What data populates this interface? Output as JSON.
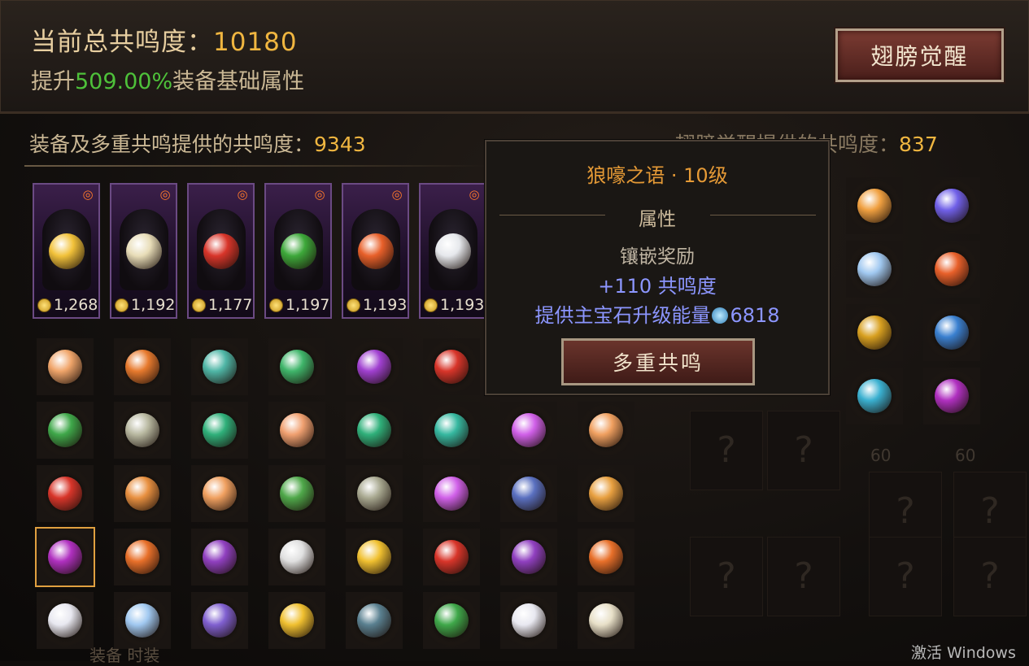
{
  "header": {
    "total_label": "当前总共鸣度：",
    "total_value": "10180",
    "boost_prefix": "提升",
    "boost_percent": "509.00%",
    "boost_suffix": "装备基础属性",
    "awaken_button": "翅膀觉醒"
  },
  "totals": {
    "left_label": "装备及多重共鸣提供的共鸣度：",
    "left_value": "9343",
    "right_label": "翅膀觉醒提供的共鸣度：",
    "right_value": "837"
  },
  "equipment_cards": [
    {
      "price": "1,268",
      "gem_color": "#f2c23a"
    },
    {
      "price": "1,192",
      "gem_color": "#e8ddb8"
    },
    {
      "price": "1,177",
      "gem_color": "#d8352a"
    },
    {
      "price": "1,197",
      "gem_color": "#3da83a"
    },
    {
      "price": "1,193",
      "gem_color": "#e8602a"
    },
    {
      "price": "1,193",
      "gem_color": "#e6e8ec"
    }
  ],
  "tooltip": {
    "title": "狼嚎之语 · 10级",
    "section": "属性",
    "bonus_title": "镶嵌奖励",
    "bonus_value": "+110 共鸣度",
    "energy_label": "提供主宝石升级能量",
    "energy_value": "6818",
    "multi_button": "多重共鸣"
  },
  "gem_grid": [
    [
      "#f0a56a",
      "#e77a2e",
      "#4fb6a6",
      "#3fb56a",
      "#a040d0",
      "#d8352a"
    ],
    [
      "#3fa84a",
      "#b8b8a0",
      "#2fb07a",
      "#f0a070",
      "#2fb07a",
      "#36b8a0",
      "#d060e8",
      "#f0a060"
    ],
    [
      "#d8352a",
      "#e89040",
      "#f0a060",
      "#4fa84a",
      "#a8a890",
      "#d060e8",
      "#5a70c0",
      "#e8a040"
    ],
    [
      "#b030c0",
      "#e8702a",
      "#9040c0",
      "#e0e0e0",
      "#f0c030",
      "#d8352a",
      "#9040c0",
      "#e8702a"
    ],
    [
      "#e8e8f0",
      "#a0c8f0",
      "#8060d0",
      "#f0c030",
      "#5a8090",
      "#3fa84a",
      "#e8e8f0",
      "#e8e0c8"
    ]
  ],
  "right_gems": [
    "#f0a040",
    "#7060e8",
    "#a0c8f0",
    "#e8602a",
    "#d8a020",
    "#3a80d0",
    "#3ab0d0",
    "#b030c0"
  ],
  "slot_labels": [
    "60",
    "60"
  ],
  "bottom_tabs": "装备    时装",
  "watermark": "激活 Windows"
}
